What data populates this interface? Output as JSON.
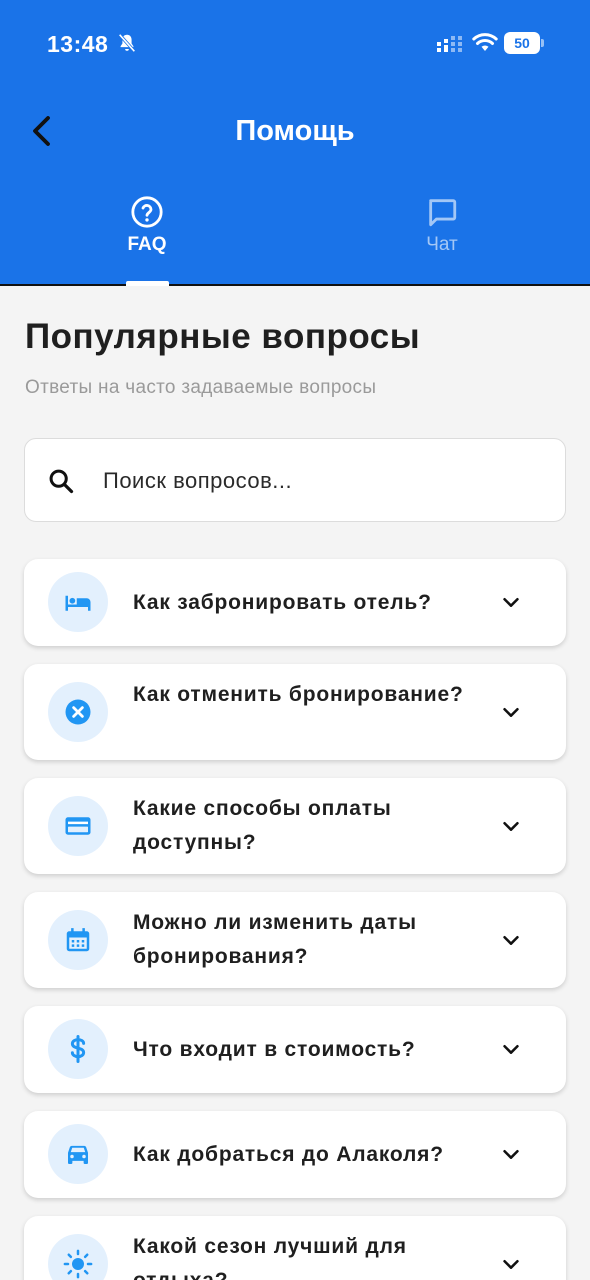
{
  "status_bar": {
    "time": "13:48",
    "battery": "50"
  },
  "header": {
    "title": "Помощь",
    "back_label": "Назад"
  },
  "tabs": [
    {
      "label": "FAQ",
      "icon": "help-circle-icon",
      "active": true
    },
    {
      "label": "Чат",
      "icon": "chat-bubble-icon",
      "active": false
    }
  ],
  "section": {
    "title": "Популярные вопросы",
    "subtitle": "Ответы на часто задаваемые вопросы"
  },
  "search": {
    "placeholder": "Поиск вопросов...",
    "value": ""
  },
  "faq_items": [
    {
      "icon": "bed-icon",
      "question": "Как забронировать отель?"
    },
    {
      "icon": "cancel-icon",
      "question": "Как отменить бронирование?"
    },
    {
      "icon": "credit-card-icon",
      "question": "Какие способы оплаты доступны?"
    },
    {
      "icon": "calendar-icon",
      "question": "Можно ли изменить даты бронирования?"
    },
    {
      "icon": "dollar-icon",
      "question": "Что входит в стоимость?"
    },
    {
      "icon": "car-icon",
      "question": "Как добраться до Алаколя?"
    },
    {
      "icon": "sun-icon",
      "question": "Какой сезон лучший для отдыха?"
    }
  ],
  "colors": {
    "primary": "#1a73e8",
    "icon_bg": "#e3f0fd",
    "background": "#f4f4f4",
    "text": "#1f1f1f",
    "muted": "#9a9a9a"
  }
}
